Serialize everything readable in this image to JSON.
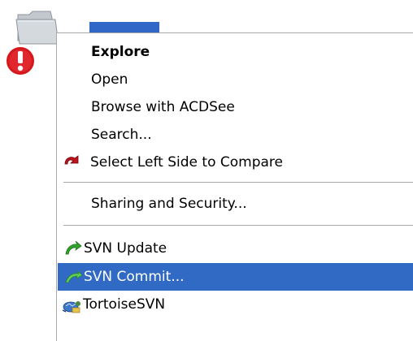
{
  "desktop": {
    "folder_icon": "folder-icon",
    "overlay_icon": "conflict-overlay-icon",
    "selection_color": "#3167c6"
  },
  "menu": {
    "items": [
      {
        "label": "Explore",
        "bold": true
      },
      {
        "label": "Open"
      },
      {
        "label": "Browse with ACDSee"
      },
      {
        "label": "Search..."
      },
      {
        "label": "Select Left Side to Compare",
        "icon": "compare-icon"
      },
      {
        "label": "Sharing and Security..."
      },
      {
        "label": "SVN Update",
        "icon": "svn-update-icon"
      },
      {
        "label": "SVN Commit...",
        "icon": "svn-commit-icon",
        "highlighted": true
      },
      {
        "label": "TortoiseSVN",
        "icon": "tortoisesvn-icon",
        "submenu": true
      }
    ],
    "highlight_color": "#316ac5"
  }
}
